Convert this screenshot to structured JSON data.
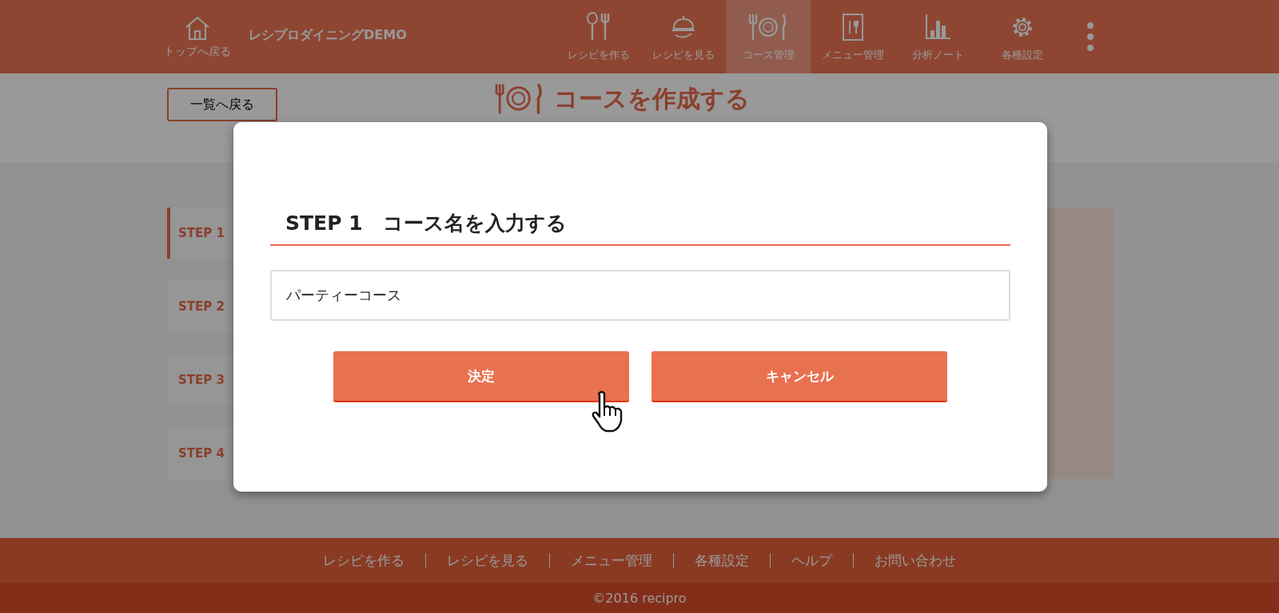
{
  "header": {
    "home_label": "トップへ戻る",
    "site_name": "レシプロダイニングDEMO",
    "nav": [
      {
        "label": "レシピを作る",
        "selected": false
      },
      {
        "label": "レシピを見る",
        "selected": false
      },
      {
        "label": "コース管理",
        "selected": true
      },
      {
        "label": "メニュー管理",
        "selected": false
      },
      {
        "label": "分析ノート",
        "selected": false
      },
      {
        "label": "各種設定",
        "selected": false
      }
    ]
  },
  "subheader": {
    "back_button": "一覧へ戻る",
    "title": "コースを作成する"
  },
  "steps": [
    {
      "label": "STEP 1",
      "selected": true
    },
    {
      "label": "STEP 2",
      "selected": false
    },
    {
      "label": "STEP 3",
      "selected": false
    },
    {
      "label": "STEP 4",
      "selected": false
    }
  ],
  "modal": {
    "heading": "STEP 1　コース名を入力する",
    "input_value": "パーティーコース",
    "buttons": [
      "決定",
      "キャンセル"
    ]
  },
  "footer": {
    "links": [
      "レシピを作る",
      "レシピを見る",
      "メニュー管理",
      "各種設定",
      "ヘルプ",
      "お問い合わせ"
    ],
    "copyright": "©2016 recipro"
  }
}
